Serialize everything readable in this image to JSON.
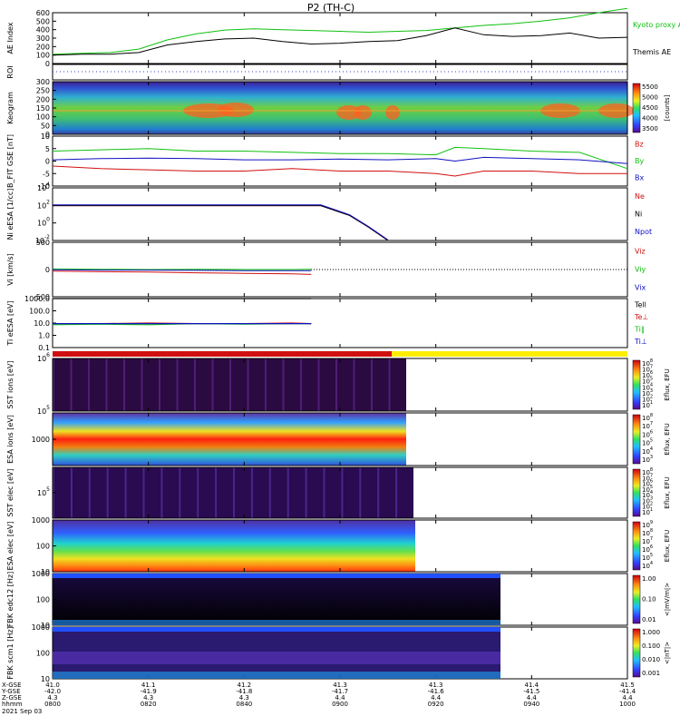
{
  "title": "P2 (TH-C)",
  "colors": {
    "black": "#000000",
    "red": "#d01010",
    "green": "#10c010",
    "blue": "#1010c0",
    "purple": "#800080",
    "yellow": "#ffee00"
  },
  "chart_data": [
    {
      "type": "line",
      "id": "ae",
      "ylabel": "AE Index",
      "ylim": [
        0,
        600
      ],
      "yticks": [
        "600",
        "500",
        "400",
        "300",
        "200",
        "100",
        "0"
      ],
      "x": [
        0,
        3,
        6,
        9,
        12,
        15,
        18,
        21,
        24,
        27,
        30,
        33,
        36,
        39,
        42,
        45,
        48,
        51,
        54,
        57,
        60
      ],
      "series": [
        {
          "name": "Kyoto proxy AE",
          "color": "#10c010",
          "values": [
            110,
            120,
            130,
            170,
            280,
            350,
            395,
            410,
            400,
            390,
            380,
            370,
            380,
            390,
            420,
            450,
            470,
            500,
            540,
            600,
            650
          ]
        },
        {
          "name": "Themis AE",
          "color": "#000000",
          "values": [
            100,
            110,
            110,
            130,
            220,
            260,
            290,
            300,
            260,
            230,
            240,
            260,
            270,
            330,
            420,
            340,
            320,
            330,
            360,
            300,
            310
          ]
        }
      ]
    },
    {
      "type": "line",
      "id": "roi",
      "ylabel": "ROI"
    },
    {
      "type": "heatmap",
      "id": "keogram",
      "ylabel": "Keogram",
      "yticks": [
        "300",
        "250",
        "200",
        "150",
        "100",
        "50",
        "0"
      ],
      "colorbar": {
        "ticks": [
          "5500",
          "5000",
          "4500",
          "4000",
          "3500"
        ],
        "label": "[counts]"
      }
    },
    {
      "type": "line",
      "id": "bfield",
      "ylabel": "B_FIT GSE [nT]",
      "ylim": [
        -10,
        10
      ],
      "yticks": [
        "10",
        "5",
        "0",
        "-5",
        "-10"
      ],
      "x": [
        0,
        5,
        10,
        15,
        20,
        25,
        30,
        35,
        40,
        42,
        45,
        50,
        55,
        60
      ],
      "series": [
        {
          "name": "Bz",
          "color": "#d01010",
          "values": [
            -2,
            -3,
            -3.5,
            -4,
            -4,
            -3,
            -4,
            -4,
            -5,
            -6,
            -4,
            -4,
            -5,
            -5
          ]
        },
        {
          "name": "By",
          "color": "#10c010",
          "values": [
            4,
            4.5,
            5,
            4,
            4,
            3.5,
            3,
            3,
            2.5,
            5.5,
            5,
            4,
            3.5,
            -3
          ]
        },
        {
          "name": "Bx",
          "color": "#1010c0",
          "values": [
            0.5,
            1,
            1.2,
            1,
            0.5,
            0.5,
            0.8,
            0.5,
            1,
            0,
            1.5,
            1,
            0.5,
            -1
          ]
        }
      ]
    },
    {
      "type": "line",
      "id": "density",
      "ylabel": "Ni eESA [1/cc]",
      "yticks": [
        "10^4",
        "10^2",
        "10^0",
        "10^-2"
      ],
      "x": [
        0,
        5,
        10,
        15,
        20,
        25,
        28,
        31,
        33,
        35
      ],
      "series": [
        {
          "name": "Ne",
          "color": "#d01010",
          "values": [
            1.8,
            1.8,
            1.8,
            1.8,
            1.8,
            1.8,
            1.8,
            0.3,
            -1.5,
            -3.5
          ]
        },
        {
          "name": "Ni",
          "color": "#000000",
          "values": [
            1.8,
            1.8,
            1.8,
            1.8,
            1.8,
            1.8,
            1.8,
            0.3,
            -1.5,
            -3.5
          ]
        },
        {
          "name": "Npot",
          "color": "#1010c0",
          "values": [
            1.9,
            1.9,
            1.9,
            1.9,
            1.9,
            1.9,
            1.9,
            0.4,
            -1.4,
            -3.4
          ]
        }
      ]
    },
    {
      "type": "line",
      "id": "velocity",
      "ylabel": "Vi [km/s]",
      "ylim": [
        -500,
        500
      ],
      "yticks": [
        "500",
        "0",
        "-500"
      ],
      "x": [
        0,
        5,
        10,
        15,
        20,
        25,
        27
      ],
      "series": [
        {
          "name": "Viz",
          "color": "#d01010",
          "values": [
            -30,
            -40,
            -45,
            -60,
            -70,
            -80,
            -90
          ]
        },
        {
          "name": "Viy",
          "color": "#10c010",
          "values": [
            10,
            5,
            0,
            5,
            0,
            0,
            5
          ]
        },
        {
          "name": "Vix",
          "color": "#1010c0",
          "values": [
            -5,
            -10,
            -10,
            -15,
            -20,
            -20,
            -20
          ]
        }
      ]
    },
    {
      "type": "line",
      "id": "temperature",
      "ylabel": "Ti eESA [eV]",
      "yticks": [
        "1000.0",
        "100.0",
        "10.0",
        "1.0",
        "0.1"
      ],
      "x": [
        0,
        5,
        10,
        15,
        20,
        25,
        27
      ],
      "series": [
        {
          "name": "Tell",
          "color": "#000000",
          "values": [
            3.5,
            3.5,
            3.5,
            3.5,
            3.5,
            3.5,
            3.5
          ]
        },
        {
          "name": "Te⊥",
          "color": "#d01010",
          "values": [
            1.2,
            1.2,
            1.25,
            1.2,
            1.2,
            1.25,
            1.2
          ]
        },
        {
          "name": "Ti‖",
          "color": "#10c010",
          "values": [
            1.1,
            1.15,
            1.1,
            1.2,
            1.15,
            1.2,
            1.2
          ]
        },
        {
          "name": "Ti⊥",
          "color": "#1010c0",
          "values": [
            1.2,
            1.2,
            1.2,
            1.2,
            1.2,
            1.2,
            1.2
          ]
        }
      ]
    },
    {
      "type": "heatmap",
      "id": "sst-ion",
      "ylabel": "SST ions [eV]",
      "yticks": [
        "10^6",
        "10^5"
      ],
      "colorbar": {
        "ticks": [
          "10^8",
          "10^7",
          "10^6",
          "10^5",
          "10^4",
          "10^3",
          "10^2",
          "10^1"
        ],
        "label": "Eflux, EFU"
      }
    },
    {
      "type": "heatmap",
      "id": "esa-ion",
      "ylabel": "ESA ions [eV]",
      "yticks": [
        "1000"
      ],
      "colorbar": {
        "ticks": [
          "10^8",
          "10^7",
          "10^6",
          "10^5",
          "10^4",
          "10^3"
        ],
        "label": "Eflux, EFU"
      }
    },
    {
      "type": "heatmap",
      "id": "sst-elec",
      "ylabel": "SST elec [eV]",
      "yticks": [
        "10^5"
      ],
      "colorbar": {
        "ticks": [
          "10^8",
          "10^7",
          "10^6",
          "10^5",
          "10^4",
          "10^3",
          "10^2",
          "10^1"
        ],
        "label": "Eflux, EFU"
      }
    },
    {
      "type": "heatmap",
      "id": "esa-elec",
      "ylabel": "ESA elec [eV]",
      "yticks": [
        "1000",
        "100",
        "10"
      ],
      "colorbar": {
        "ticks": [
          "10^9",
          "10^8",
          "10^7",
          "10^6",
          "10^5",
          "10^4"
        ],
        "label": "Eflux, EFU"
      }
    },
    {
      "type": "heatmap",
      "id": "fbk-e",
      "ylabel": "FBK edc12 [Hz]",
      "yticks": [
        "1000",
        "100",
        "10"
      ],
      "colorbar": {
        "ticks": [
          "1.00",
          "0.10",
          "0.01"
        ],
        "label": "<|mV/m|>"
      }
    },
    {
      "type": "heatmap",
      "id": "fbk-b",
      "ylabel": "FBK scm1 [Hz]",
      "yticks": [
        "1000",
        "100",
        "10"
      ],
      "colorbar": {
        "ticks": [
          "1.000",
          "0.100",
          "0.010",
          "0.001"
        ],
        "label": "<|nT|>"
      }
    }
  ],
  "x_axis": {
    "row_labels": [
      "X-GSE",
      "Y-GSE",
      "Z-GSE",
      "hhmm",
      "2021 Sep 03"
    ],
    "columns": [
      {
        "x": "41.0",
        "y": "-42.0",
        "z": "4.3",
        "t": "0800"
      },
      {
        "x": "41.1",
        "y": "-41.9",
        "z": "4.3",
        "t": "0820"
      },
      {
        "x": "41.2",
        "y": "-41.8",
        "z": "4.3",
        "t": "0840"
      },
      {
        "x": "41.3",
        "y": "-41.7",
        "z": "4.4",
        "t": "0900"
      },
      {
        "x": "41.3",
        "y": "-41.6",
        "z": "4.4",
        "t": "0920"
      },
      {
        "x": "41.4",
        "y": "-41.5",
        "z": "4.4",
        "t": "0940"
      },
      {
        "x": "41.5",
        "y": "-41.4",
        "z": "4.4",
        "t": "1000"
      }
    ]
  }
}
